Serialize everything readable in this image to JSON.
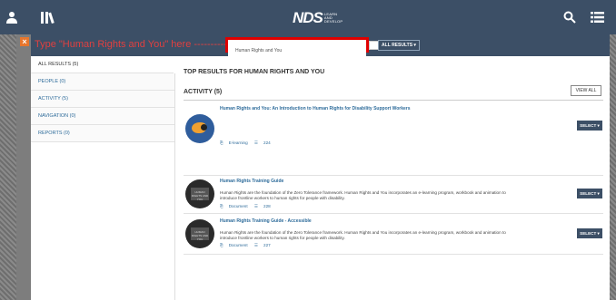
{
  "header": {
    "brand": "NDS",
    "tagline": [
      "LEARN",
      "AND",
      "DEVELOP"
    ],
    "icons": [
      "user-icon",
      "library-icon",
      "search-icon",
      "menu-icon"
    ]
  },
  "annotation": "Type \"Human Rights and You\" here ------------->",
  "search": {
    "value": "Human Rights and You",
    "filter_label": "ALL RESULTS ▾"
  },
  "sidebar": {
    "items": [
      {
        "label": "ALL RESULTS (5)",
        "active": true
      },
      {
        "label": "PEOPLE (0)",
        "active": false
      },
      {
        "label": "ACTIVITY (5)",
        "active": false
      },
      {
        "label": "NAVIGATION (0)",
        "active": false
      },
      {
        "label": "REPORTS (0)",
        "active": false
      }
    ]
  },
  "main": {
    "top_title": "TOP RESULTS FOR HUMAN RIGHTS AND YOU",
    "activity_title": "ACTIVITY (5)",
    "view_all": "VIEW ALL",
    "select_label": "SELECT ▾",
    "results": [
      {
        "title": "Human Rights and You: An Introduction to Human Rights for Disability Support Workers",
        "description": "",
        "type": "E-learning",
        "views": "224"
      },
      {
        "title": "Human Rights Training Guide",
        "description": "Human Rights are the foundation of the Zero Tolerance framework. Human Rights and You incorporates an e-learning program, workbook and animation to introduce frontline workers to human rights for people with disability.",
        "type": "Document",
        "views": "228",
        "thumb_text": "HUMAN RIGHTS AND YOU"
      },
      {
        "title": "Human Rights Training Guide - Accessible",
        "description": "Human Rights are the foundation of the Zero Tolerance framework. Human Rights and You incorporates an e-learning program, workbook and animation to introduce frontline workers to human rights for people with disability.",
        "type": "Document",
        "views": "227",
        "thumb_text": "HUMAN RIGHTS AND YOU"
      }
    ]
  },
  "colors": {
    "nav_bg": "#3c4f66",
    "link": "#2d6b9a",
    "annotation": "#e04040",
    "highlight_border": "#e00000",
    "close_bg": "#e8762c"
  }
}
